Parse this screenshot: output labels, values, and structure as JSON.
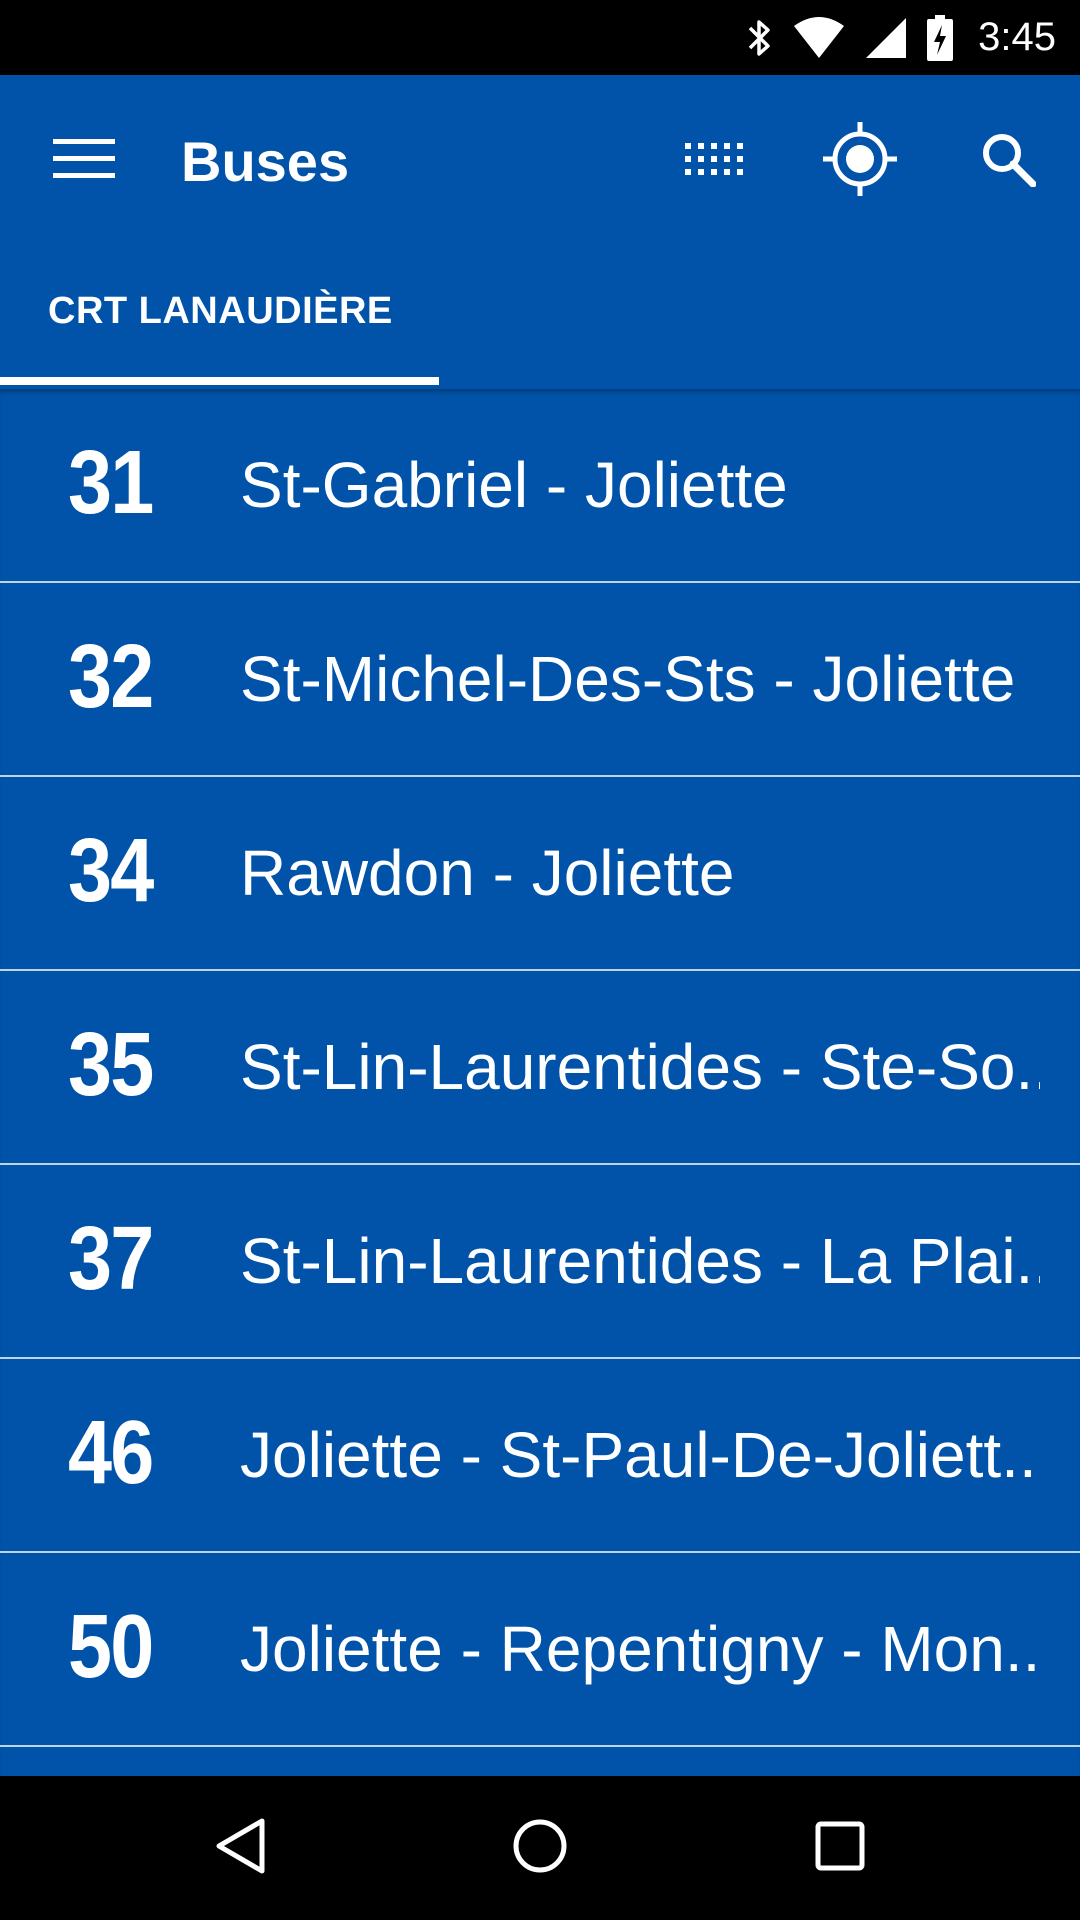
{
  "status_bar": {
    "time": "3:45",
    "icons": [
      "bluetooth-icon",
      "wifi-icon",
      "signal-icon",
      "battery-charging-icon"
    ]
  },
  "app_bar": {
    "title": "Buses",
    "actions": [
      "menu-icon",
      "grid-icon",
      "my-location-icon",
      "search-icon"
    ]
  },
  "tabs": [
    {
      "label": "CRT LANAUDIÈRE",
      "selected": true
    }
  ],
  "routes": [
    {
      "number": "31",
      "name": "St-Gabriel - Joliette"
    },
    {
      "number": "32",
      "name": "St-Michel-Des-Sts - Joliette"
    },
    {
      "number": "34",
      "name": "Rawdon - Joliette"
    },
    {
      "number": "35",
      "name": "St-Lin-Laurentides - Ste-So.."
    },
    {
      "number": "37",
      "name": "St-Lin-Laurentides - La Plai.."
    },
    {
      "number": "46",
      "name": "Joliette - St-Paul-De-Joliett.."
    },
    {
      "number": "50",
      "name": "Joliette - Repentigny - Mon.."
    }
  ],
  "nav_bar": {
    "buttons": [
      "back-icon",
      "home-icon",
      "recents-icon"
    ]
  },
  "colors": {
    "primary": "#0053a8",
    "text": "#ffffff",
    "status_bar": "#000000"
  }
}
